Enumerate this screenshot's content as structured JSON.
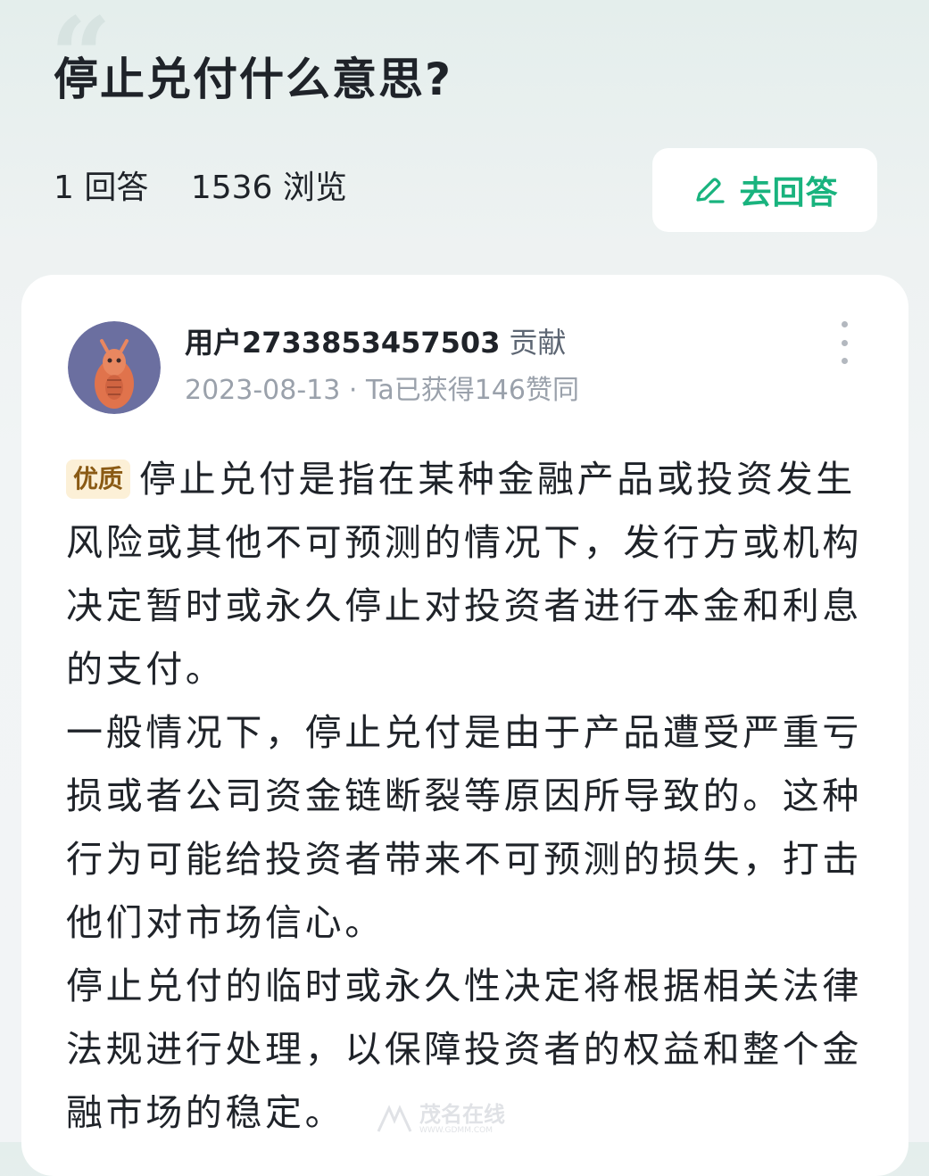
{
  "question": {
    "title": "停止兑付什么意思?",
    "answers_count": "1 回答",
    "views_count": "1536 浏览",
    "answer_button_label": "去回答"
  },
  "answer": {
    "user_name": "用户2733853457503",
    "user_role": "贡献",
    "meta": "2023-08-13 · Ta已获得146赞同",
    "quality_badge": "优质",
    "paragraphs": [
      "停止兑付是指在某种金融产品或投资发生风险或其他不可预测的情况下，发行方或机构决定暂时或永久停止对投资者进行本金和利息的支付。",
      "一般情况下，停止兑付是由于产品遭受严重亏损或者公司资金链断裂等原因所导致的。这种行为可能给投资者带来不可预测的损失，打击他们对市场信心。",
      "停止兑付的临时或永久性决定将根据相关法律法规进行处理，以保障投资者的权益和整个金融市场的稳定。"
    ]
  },
  "watermark": {
    "text": "茂名在线",
    "url": "WWW.GDMM.COM"
  },
  "colors": {
    "accent": "#19b37e",
    "badge_bg": "#fcf0d7",
    "badge_text": "#8a5a14",
    "muted": "#9aa1ab"
  },
  "icons": {
    "quote": "quote-mark-icon",
    "answer_button": "pen-write-icon",
    "more": "more-vertical-icon"
  }
}
